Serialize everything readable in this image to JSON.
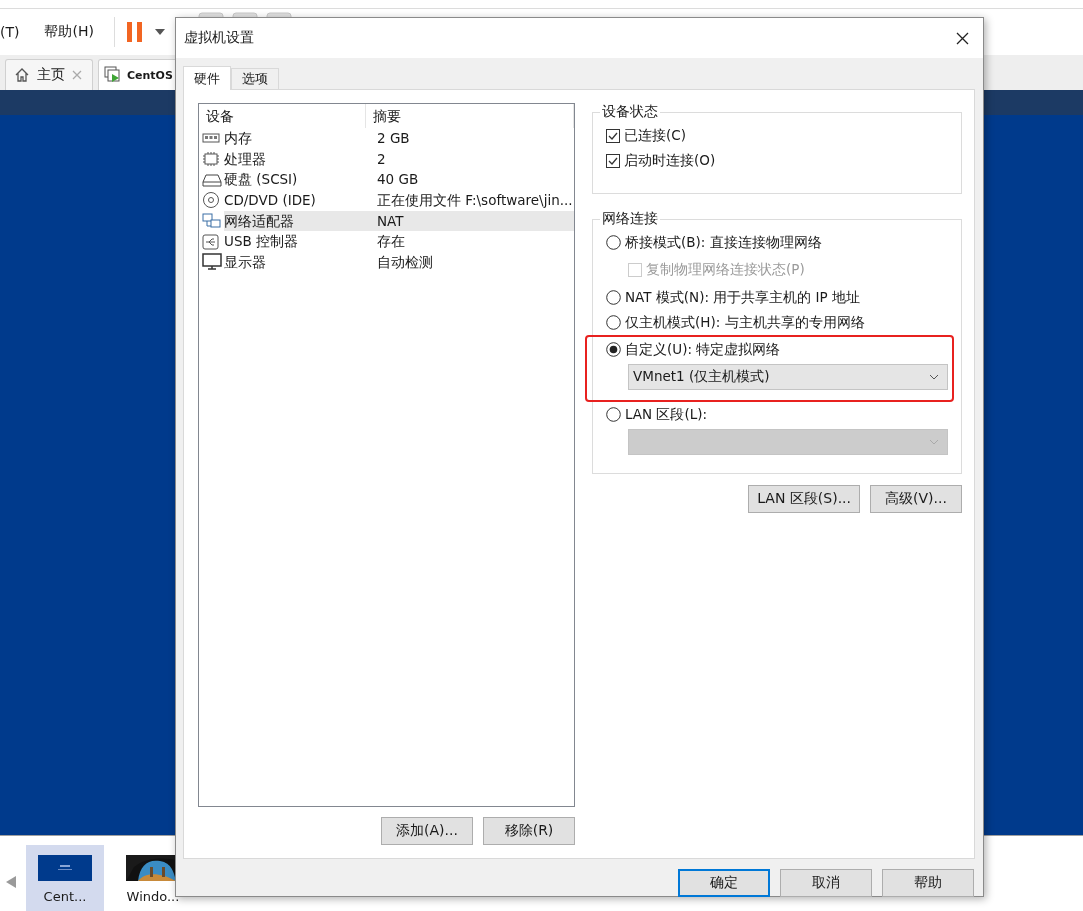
{
  "app": {
    "menu": [
      {
        "label": "(T)"
      },
      {
        "label": "帮助(H)"
      }
    ],
    "tabs": [
      {
        "label": "主页",
        "kind": "home",
        "selected": false
      },
      {
        "label": "CentOS",
        "kind": "vm",
        "selected": true
      }
    ],
    "thumbnails": [
      {
        "label": "Cent...",
        "kind": "blue",
        "selected": true
      },
      {
        "label": "Windo...",
        "selected": false
      }
    ]
  },
  "dialog": {
    "title": "虚拟机设置",
    "tabs": [
      {
        "label": "硬件",
        "selected": true
      },
      {
        "label": "选项",
        "selected": false
      }
    ],
    "devices": {
      "columns": [
        "设备",
        "摘要"
      ],
      "rows": [
        {
          "kind": "memory",
          "name": "内存",
          "summary": "2 GB",
          "selected": false
        },
        {
          "kind": "cpu",
          "name": "处理器",
          "summary": "2",
          "selected": false
        },
        {
          "kind": "disk",
          "name": "硬盘 (SCSI)",
          "summary": "40 GB",
          "selected": false
        },
        {
          "kind": "cd",
          "name": "CD/DVD (IDE)",
          "summary": "正在使用文件 F:\\software\\jin...",
          "selected": false
        },
        {
          "kind": "network",
          "name": "网络适配器",
          "summary": "NAT",
          "selected": true
        },
        {
          "kind": "usb",
          "name": "USB 控制器",
          "summary": "存在",
          "selected": false
        },
        {
          "kind": "display",
          "name": "显示器",
          "summary": "自动检测",
          "selected": false
        }
      ]
    },
    "device_buttons": [
      "添加(A)...",
      "移除(R)"
    ],
    "device_status": {
      "title": "设备状态",
      "options": [
        {
          "label": "已连接(C)",
          "checked": true
        },
        {
          "label": "启动时连接(O)",
          "checked": true
        }
      ]
    },
    "network": {
      "title": "网络连接",
      "options": [
        {
          "label": "桥接模式(B): 直接连接物理网络",
          "selected": false,
          "highlighted": false,
          "checkbox": {
            "label": "复制物理网络连接状态(P)",
            "checked": false,
            "disabled": true
          }
        },
        {
          "label": "NAT 模式(N): 用于共享主机的 IP 地址",
          "selected": false,
          "highlighted": false
        },
        {
          "label": "仅主机模式(H): 与主机共享的专用网络",
          "selected": false,
          "highlighted": false
        },
        {
          "label": "自定义(U): 特定虚拟网络",
          "selected": true,
          "highlighted": true,
          "dropdown": {
            "value": "VMnet1 (仅主机模式)",
            "disabled": false
          }
        },
        {
          "label": "LAN 区段(L):",
          "selected": false,
          "highlighted": false,
          "dropdown": {
            "disabled": true
          }
        }
      ],
      "buttons": [
        "LAN 区段(S)...",
        "高级(V)..."
      ]
    },
    "buttons": [
      {
        "label": "确定",
        "default": true
      },
      {
        "label": "取消",
        "default": false
      },
      {
        "label": "帮助",
        "default": false
      }
    ]
  }
}
